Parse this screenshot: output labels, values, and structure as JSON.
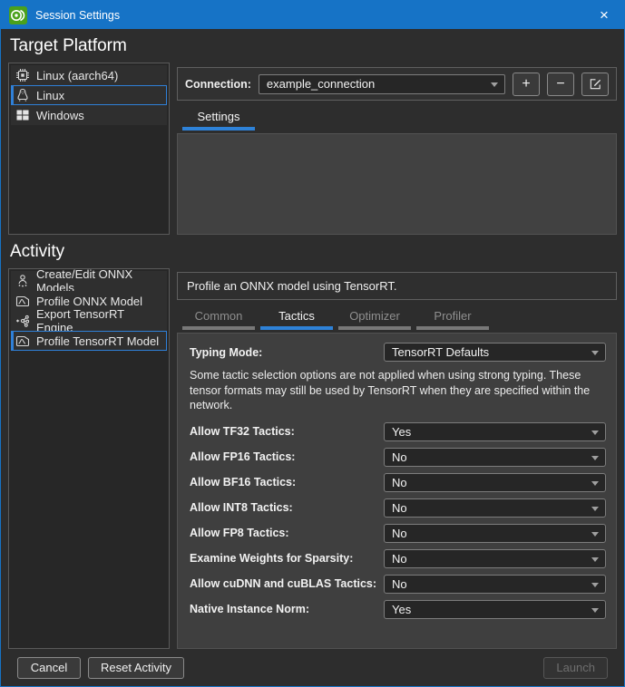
{
  "titlebar": {
    "title": "Session Settings",
    "close_glyph": "×"
  },
  "target_platform": {
    "heading": "Target Platform",
    "platforms": [
      {
        "label": "Linux (aarch64)"
      },
      {
        "label": "Linux"
      },
      {
        "label": "Windows"
      }
    ],
    "selected_platform": "Linux",
    "connection": {
      "label": "Connection:",
      "value": "example_connection",
      "add_glyph": "+",
      "remove_glyph": "−"
    },
    "settings_tab": "Settings"
  },
  "activity": {
    "heading": "Activity",
    "items": [
      {
        "label": "Create/Edit ONNX Models"
      },
      {
        "label": "Profile ONNX Model"
      },
      {
        "label": "Export TensorRT Engine"
      },
      {
        "label": "Profile TensorRT Model"
      }
    ],
    "selected_item": "Profile TensorRT Model",
    "description": "Profile an ONNX model using TensorRT.",
    "tabs": [
      {
        "label": "Common"
      },
      {
        "label": "Tactics"
      },
      {
        "label": "Optimizer"
      },
      {
        "label": "Profiler"
      }
    ],
    "active_tab": "Tactics"
  },
  "tactics_form": {
    "typing_mode": {
      "label": "Typing Mode:",
      "value": "TensorRT Defaults"
    },
    "note": "Some tactic selection options are not applied when using strong typing. These tensor formats may still be used by TensorRT when they are specified within the network.",
    "fields": [
      {
        "label": "Allow TF32 Tactics:",
        "value": "Yes"
      },
      {
        "label": "Allow FP16 Tactics:",
        "value": "No"
      },
      {
        "label": "Allow BF16 Tactics:",
        "value": "No"
      },
      {
        "label": "Allow INT8 Tactics:",
        "value": "No"
      },
      {
        "label": "Allow FP8 Tactics:",
        "value": "No"
      },
      {
        "label": "Examine Weights for Sparsity:",
        "value": "No"
      },
      {
        "label": "Allow cuDNN and cuBLAS Tactics:",
        "value": "No"
      },
      {
        "label": "Native Instance Norm:",
        "value": "Yes"
      }
    ]
  },
  "footer": {
    "cancel_label": "Cancel",
    "reset_label": "Reset Activity",
    "launch_label": "Launch"
  },
  "colors": {
    "titlebar_blue": "#1673c6",
    "accent_blue": "#2e82d8",
    "window_bg": "#2d2d2d",
    "panel_bg": "#3f3f3f",
    "app_icon_green": "#4aa11c"
  }
}
